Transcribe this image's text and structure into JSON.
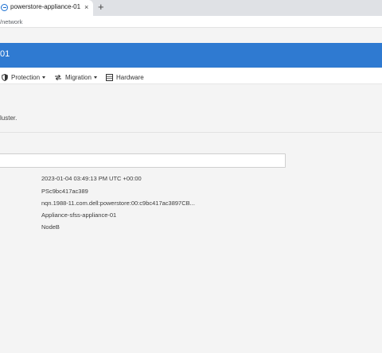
{
  "browser": {
    "tab_title": "powerstore-appliance-01",
    "tab_close": "×",
    "new_tab": "+",
    "address": "/network"
  },
  "header": {
    "title": "01"
  },
  "nav": {
    "protection": "Protection",
    "migration": "Migration",
    "hardware": "Hardware"
  },
  "content": {
    "description": "luster.",
    "filter_value": "",
    "details": [
      "2023-01-04 03:49:13 PM UTC +00:00",
      "PSc9bc417ac389",
      "nqn.1988-11.com.dell:powerstore:00:c9bc417ac3897CB...",
      "Appliance-sfss-appliance-01",
      "NodeB"
    ]
  },
  "colors": {
    "header_blue": "#2f7ad1",
    "page_bg": "#f4f4f4"
  }
}
